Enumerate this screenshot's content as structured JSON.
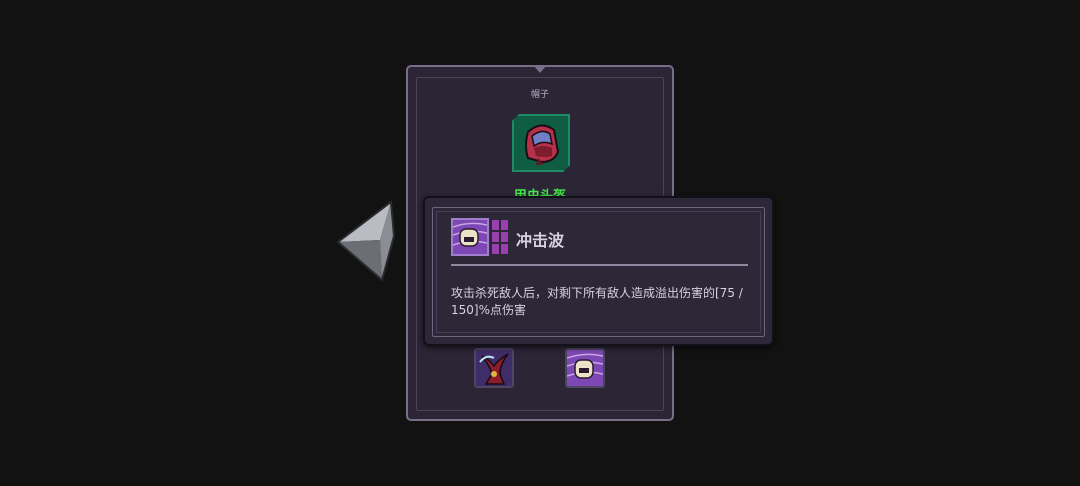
{
  "panel": {
    "slot_title": "帽子",
    "item_name": "甲虫头盔",
    "item_name_color": "#45e64a",
    "item_icon": "beetle-helmet-icon",
    "skills": [
      {
        "icon": "horned-demon-skill-icon"
      },
      {
        "icon": "shockwave-skill-icon"
      }
    ]
  },
  "nav": {
    "left_arrow_icon": "left-arrow-icon"
  },
  "tooltip": {
    "skill_name": "冲击波",
    "skill_icon": "shockwave-skill-icon",
    "description": "攻击杀死敌人后，对剩下所有敌人造成溢出伤害的[75 / 150]%点伤害",
    "level_pips_color": "#9a3fb0"
  }
}
